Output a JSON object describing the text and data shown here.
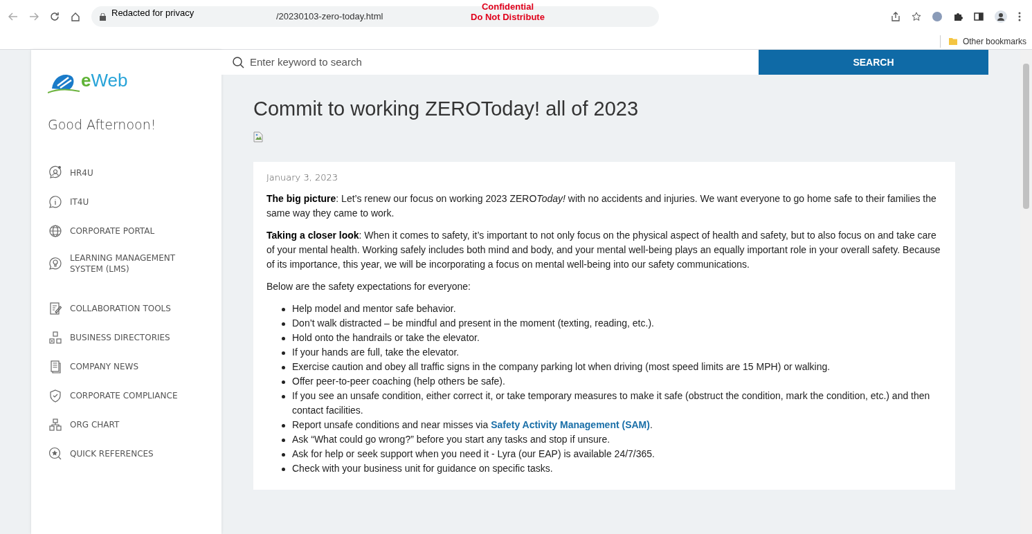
{
  "browser": {
    "url_host": "Redacted for privacy",
    "url_path": "/20230103-zero-today.html",
    "overlay": [
      "Confidential",
      "Do Not Distribute"
    ],
    "bookmark": "Other bookmarks"
  },
  "sidebar": {
    "logo": "eWeb",
    "greeting": "Good Afternoon!",
    "groups": [
      {
        "items": [
          "HR4U",
          "IT4U",
          "CORPORATE PORTAL",
          "LEARNING MANAGEMENT SYSTEM (LMS)"
        ]
      },
      {
        "items": [
          "COLLABORATION TOOLS",
          "BUSINESS DIRECTORIES",
          "COMPANY NEWS",
          "CORPORATE COMPLIANCE",
          "ORG CHART",
          "QUICK REFERENCES"
        ]
      }
    ]
  },
  "search": {
    "placeholder": "Enter keyword to search",
    "button": "SEARCH"
  },
  "article": {
    "title": "Commit to working ZEROToday! all of 2023",
    "date": "January 3, 2023",
    "paragraphs": [
      {
        "runs": [
          {
            "text": "The big picture",
            "bold": true
          },
          {
            "text": ": Let’s renew our focus on working 2023 ZERO"
          },
          {
            "text": "Today!",
            "italic": true
          },
          {
            "text": " with no accidents and injuries. We want everyone to go home safe to their families the same way they came to work."
          }
        ]
      },
      {
        "runs": [
          {
            "text": "Taking a closer look",
            "bold": true
          },
          {
            "text": ": When it comes to safety, it’s important to not only focus on the physical aspect of health and safety, but to also focus on and take care of your mental health. Working safely includes both mind and body, and your mental well-being plays an equally important role in your overall safety. Because of its importance, this year, we will be incorporating a focus on mental well-being into our safety communications."
          }
        ]
      },
      {
        "runs": [
          {
            "text": "Below are the safety expectations for everyone:"
          }
        ]
      }
    ],
    "bullets": [
      {
        "text": "Help model and mentor safe behavior."
      },
      {
        "text": "Don’t walk distracted – be mindful and present in the moment (texting, reading, etc.)."
      },
      {
        "text": "Hold onto the handrails or take the elevator."
      },
      {
        "text": "If your hands are full, take the elevator."
      },
      {
        "text": "Exercise caution and obey all traffic signs in the company parking lot when driving (most speed limits are 15 MPH) or walking."
      },
      {
        "text": "Offer peer-to-peer coaching (help others be safe)."
      },
      {
        "text": "If you see an unsafe condition, either correct it, or take temporary measures to make it safe (obstruct the condition, mark the condition, etc.) and then contact facilities."
      },
      {
        "text": "Report unsafe conditions and near misses via",
        "link": "Safety Activity Management (SAM)",
        "tail": "."
      },
      {
        "text": "Ask “What could go wrong?” before you start any tasks and stop if unsure."
      },
      {
        "text": "Ask for help or seek support when you need it - Lyra (our EAP) is available 24/7/365."
      },
      {
        "text": "Check with your business unit for guidance on specific tasks."
      }
    ]
  }
}
